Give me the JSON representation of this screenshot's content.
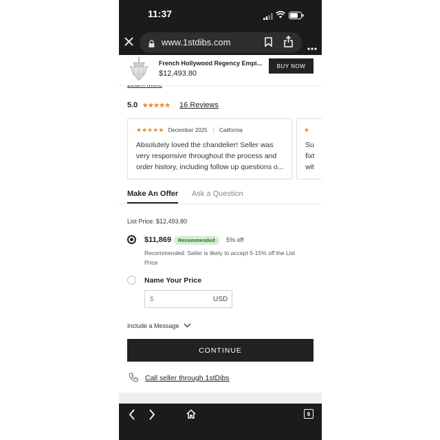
{
  "status_bar": {
    "time": "11:37"
  },
  "browser": {
    "url": "www.1stdibs.com",
    "tab_count": "6"
  },
  "product": {
    "name": "French Hollywood Regency Empi...",
    "price": "$12,493.80",
    "buy_label": "BUY NOW"
  },
  "learn_more": "Learn More",
  "rating": {
    "score": "5.0",
    "stars": "★★★★★",
    "reviews_link": "16 Reviews"
  },
  "review_card": {
    "stars": "★★★★★",
    "date": "December 2025",
    "location": "California",
    "text": "Absolutely loved the chandelier! Seller was very responsive throughout the process and order history, including follow up questions o..."
  },
  "review_card_2": {
    "stars": "★",
    "text_lines": [
      "Su",
      "fixt",
      "wit"
    ]
  },
  "tabs": {
    "make_offer": "Make An Offer",
    "ask_question": "Ask a Question"
  },
  "list_price": "List Price: $12,493.80",
  "offer": {
    "recommended_price": "$11,869",
    "badge": "Recommended",
    "discount": "5% off",
    "note": "Recommended: Seller is likely to accept 5-15% off the List Price",
    "name_your_price": "Name Your Price",
    "currency_symbol": "$",
    "currency": "USD"
  },
  "include_message": "Include a Message",
  "continue_label": "CONTINUE",
  "call_seller": "Call seller through 1stDibs",
  "colors": {
    "chrome": "#1b1b1b",
    "accent_star": "#e88a2a",
    "badge_bg": "#d6edd4",
    "badge_text": "#2c6b2c"
  }
}
